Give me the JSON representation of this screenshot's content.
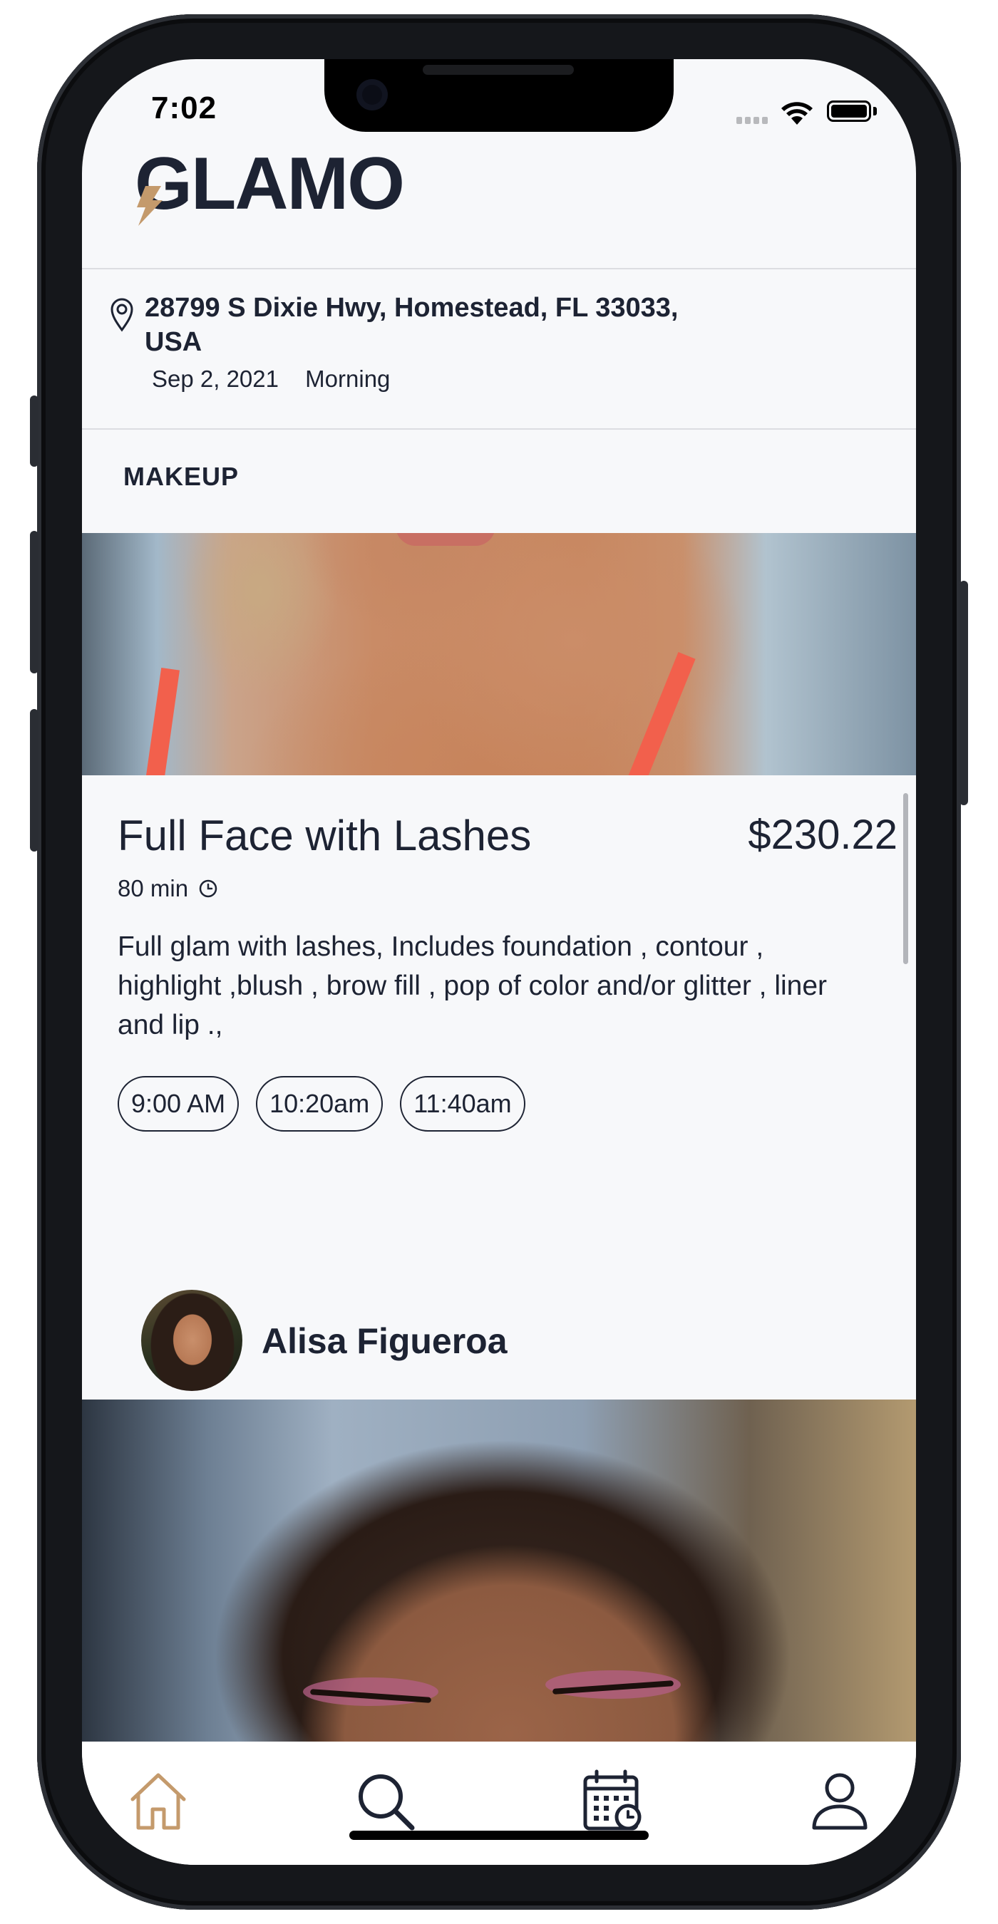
{
  "status_bar": {
    "time": "7:02"
  },
  "header": {
    "logo_text": "GLAMO"
  },
  "booking": {
    "address": "28799 S Dixie Hwy, Homestead, FL 33033, USA",
    "date": "Sep 2, 2021",
    "time_of_day": "Morning"
  },
  "category": {
    "label": "MAKEUP"
  },
  "service": {
    "title": "Full Face with Lashes",
    "price": "$230.22",
    "duration": "80 min",
    "description": "Full glam with lashes, Includes foundation , contour , highlight ,blush , brow fill , pop of color and/or glitter , liner and lip .,",
    "time_slots": [
      "9:00 AM",
      "10:20am",
      "11:40am"
    ]
  },
  "artist": {
    "name": "Alisa Figueroa"
  },
  "tab_bar": {
    "items": [
      {
        "icon": "home-icon",
        "active": true
      },
      {
        "icon": "search-icon",
        "active": false
      },
      {
        "icon": "calendar-icon",
        "active": false
      },
      {
        "icon": "profile-icon",
        "active": false
      }
    ]
  },
  "colors": {
    "text": "#1d2333",
    "accent": "#c49a6c",
    "background": "#f7f8fa",
    "slot_border": "#1d2333"
  }
}
